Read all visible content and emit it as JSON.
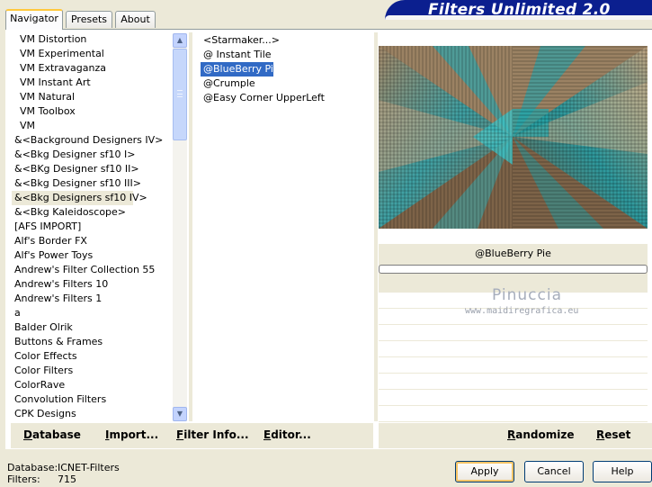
{
  "tabs": [
    {
      "label": "Navigator"
    },
    {
      "label": "Presets"
    },
    {
      "label": "About"
    }
  ],
  "banner": {
    "title": "Filters Unlimited 2.0"
  },
  "categories": [
    {
      "label": "VM Distortion"
    },
    {
      "label": "VM Experimental"
    },
    {
      "label": "VM Extravaganza"
    },
    {
      "label": "VM Instant Art"
    },
    {
      "label": "VM Natural"
    },
    {
      "label": "VM Toolbox"
    },
    {
      "label": "VM"
    },
    {
      "label": "&<Background Designers IV>"
    },
    {
      "label": "&<Bkg Designer sf10 I>"
    },
    {
      "label": "&<BKg Designer sf10 II>"
    },
    {
      "label": "&<Bkg Designer sf10 III>"
    },
    {
      "label": "&<Bkg Designers sf10 IV>"
    },
    {
      "label": "&<Bkg Kaleidoscope>"
    },
    {
      "label": "[AFS IMPORT]"
    },
    {
      "label": "Alf's Border FX"
    },
    {
      "label": "Alf's Power Toys"
    },
    {
      "label": "Andrew's Filter Collection 55"
    },
    {
      "label": "Andrew's Filters 10"
    },
    {
      "label": "Andrew's Filters 1"
    },
    {
      "label": "a"
    },
    {
      "label": "Balder Olrik"
    },
    {
      "label": "Buttons & Frames"
    },
    {
      "label": "Color Effects"
    },
    {
      "label": "Color Filters"
    },
    {
      "label": "ColorRave"
    },
    {
      "label": "Convolution Filters"
    },
    {
      "label": "CPK Designs"
    }
  ],
  "filters": [
    {
      "label": "<Starmaker...>"
    },
    {
      "label": "@ Instant Tile"
    },
    {
      "label": "@BlueBerry Pie"
    },
    {
      "label": "@Crumple"
    },
    {
      "label": "@Easy Corner UpperLeft"
    }
  ],
  "preview": {
    "filter_name": "@BlueBerry Pie",
    "progress": 0,
    "watermark_title": "Pinuccia",
    "watermark_url": "www.maidiregrafica.eu"
  },
  "toolbar_left": {
    "database": "Database",
    "import": "Import...",
    "filter_info": "Filter Info...",
    "editor": "Editor..."
  },
  "toolbar_right": {
    "randomize": "Randomize",
    "reset": "Reset"
  },
  "status": {
    "database_label": "Database:",
    "database_value": "ICNET-Filters",
    "filters_label": "Filters:",
    "filters_value": "715"
  },
  "dialog": {
    "apply": "Apply",
    "cancel": "Cancel",
    "help": "Help"
  },
  "colors": {
    "selection": "#316ac5",
    "panel": "#ece9d8",
    "banner": "#0b1f8f"
  }
}
